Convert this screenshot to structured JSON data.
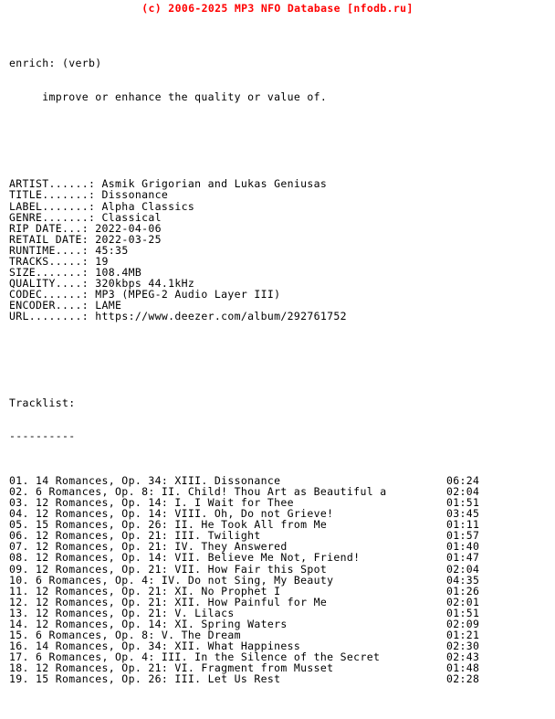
{
  "header": {
    "copyright": "(c) 2006-2025 MP3 NFO Database [nfodb.ru]",
    "color": "#ff0000"
  },
  "definition": {
    "term": "enrich: (verb)",
    "meaning": "     improve or enhance the quality or value of."
  },
  "metadata": {
    "fields": [
      {
        "label": "ARTIST......:",
        "value": "Asmik Grigorian and Lukas Geniusas"
      },
      {
        "label": "TITLE.......:",
        "value": "Dissonance"
      },
      {
        "label": "LABEL.......:",
        "value": "Alpha Classics"
      },
      {
        "label": "GENRE.......:",
        "value": "Classical"
      },
      {
        "label": "RIP DATE...:",
        "value": "2022-04-06"
      },
      {
        "label": "RETAIL DATE:",
        "value": "2022-03-25"
      },
      {
        "label": "RUNTIME....:",
        "value": "45:35"
      },
      {
        "label": "TRACKS.....:",
        "value": "19"
      },
      {
        "label": "SIZE.......:",
        "value": "108.4MB"
      },
      {
        "label": "QUALITY....:",
        "value": "320kbps 44.1kHz"
      },
      {
        "label": "CODEC......:",
        "value": "MP3 (MPEG-2 Audio Layer III)"
      },
      {
        "label": "ENCODER....:",
        "value": "LAME"
      },
      {
        "label": "URL........:",
        "value": "https://www.deezer.com/album/292761752"
      }
    ]
  },
  "tracklist": {
    "title": "Tracklist:",
    "rule": "----------",
    "tracks": [
      {
        "num": "01.",
        "title": "14 Romances, Op. 34: XIII. Dissonance",
        "duration": "06:24"
      },
      {
        "num": "02.",
        "title": "6 Romances, Op. 8: II. Child! Thou Art as Beautiful a",
        "duration": "02:04"
      },
      {
        "num": "03.",
        "title": "12 Romances, Op. 14: I. I Wait for Thee",
        "duration": "01:51"
      },
      {
        "num": "04.",
        "title": "12 Romances, Op. 14: VIII. Oh, Do not Grieve!",
        "duration": "03:45"
      },
      {
        "num": "05.",
        "title": "15 Romances, Op. 26: II. He Took All from Me",
        "duration": "01:11"
      },
      {
        "num": "06.",
        "title": "12 Romances, Op. 21: III. Twilight",
        "duration": "01:57"
      },
      {
        "num": "07.",
        "title": "12 Romances, Op. 21: IV. They Answered",
        "duration": "01:40"
      },
      {
        "num": "08.",
        "title": "12 Romances, Op. 14: VII. Believe Me Not, Friend!",
        "duration": "01:47"
      },
      {
        "num": "09.",
        "title": "12 Romances, Op. 21: VII. How Fair this Spot",
        "duration": "02:04"
      },
      {
        "num": "10.",
        "title": "6 Romances, Op. 4: IV. Do not Sing, My Beauty",
        "duration": "04:35"
      },
      {
        "num": "11.",
        "title": "12 Romances, Op. 21: XI. No Prophet I",
        "duration": "01:26"
      },
      {
        "num": "12.",
        "title": "12 Romances, Op. 21: XII. How Painful for Me",
        "duration": "02:01"
      },
      {
        "num": "13.",
        "title": "12 Romances, Op. 21: V. Lilacs",
        "duration": "01:51"
      },
      {
        "num": "14.",
        "title": "12 Romances, Op. 14: XI. Spring Waters",
        "duration": "02:09"
      },
      {
        "num": "15.",
        "title": "6 Romances, Op. 8: V. The Dream",
        "duration": "01:21"
      },
      {
        "num": "16.",
        "title": "14 Romances, Op. 34: XII. What Happiness",
        "duration": "02:30"
      },
      {
        "num": "17.",
        "title": "6 Romances, Op. 4: III. In the Silence of the Secret",
        "duration": "02:43"
      },
      {
        "num": "18.",
        "title": "12 Romances, Op. 21: VI. Fragment from Musset",
        "duration": "01:48"
      },
      {
        "num": "19.",
        "title": "15 Romances, Op. 26: III. Let Us Rest",
        "duration": "02:28"
      }
    ]
  }
}
